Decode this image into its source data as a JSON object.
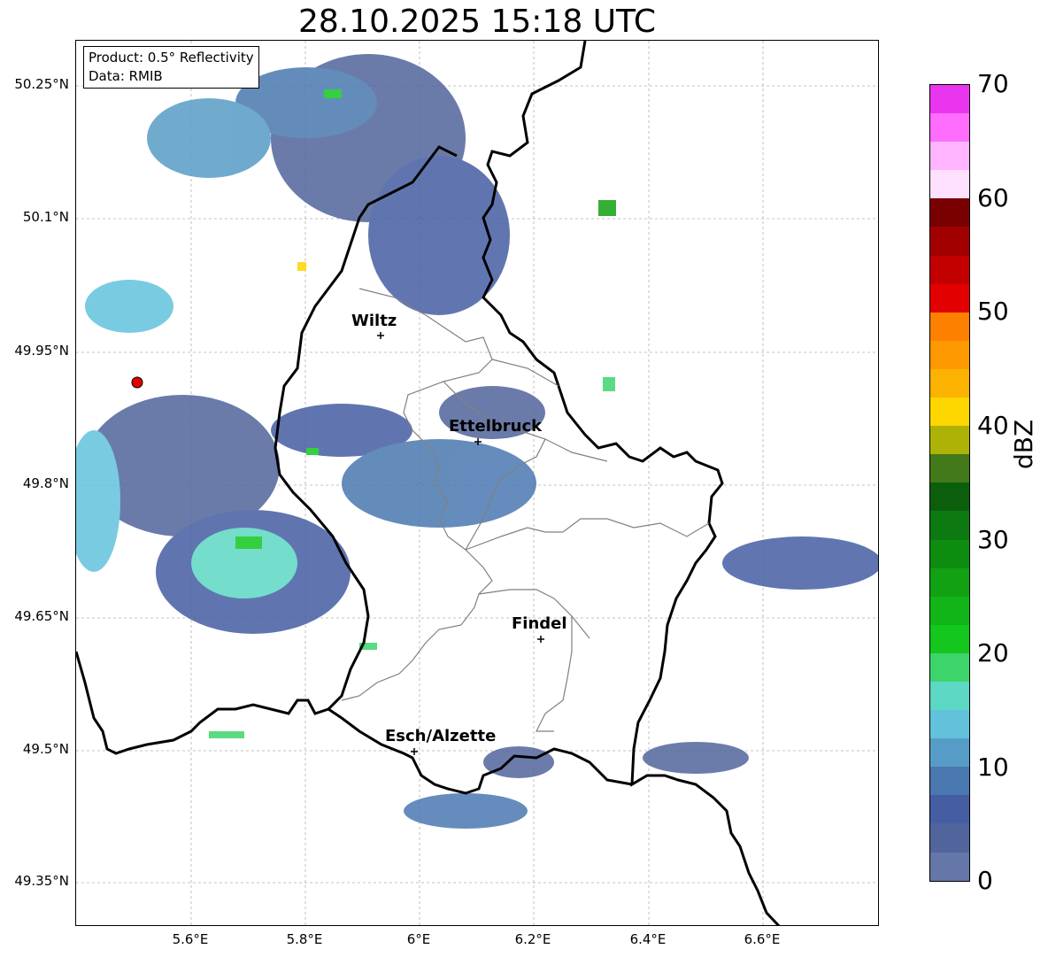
{
  "title": "28.10.2025 15:18 UTC",
  "info": {
    "product": "Product: 0.5° Reflectivity",
    "data": "Data: RMIB"
  },
  "lat_ticks": [
    "50.25°N",
    "50.1°N",
    "49.95°N",
    "49.8°N",
    "49.65°N",
    "49.5°N",
    "49.35°N"
  ],
  "lon_ticks": [
    "5.6°E",
    "5.8°E",
    "6°E",
    "6.2°E",
    "6.4°E",
    "6.6°E"
  ],
  "cities": {
    "wiltz": "Wiltz",
    "ettelbruck": "Ettelbruck",
    "findel": "Findel",
    "esch": "Esch/Alzette"
  },
  "colorbar": {
    "label": "dBZ",
    "ticks": [
      "70",
      "60",
      "50",
      "40",
      "30",
      "20",
      "10",
      "0"
    ],
    "colors": [
      "#6577a8",
      "#51659c",
      "#455ea3",
      "#4a78b0",
      "#579cc6",
      "#62c2dc",
      "#5cd8c4",
      "#3ed46c",
      "#13c71e",
      "#11b517",
      "#11a113",
      "#0e8c10",
      "#0c7a10",
      "#0b5f0c",
      "#43791a",
      "#aeb206",
      "#fed600",
      "#fcb200",
      "#fe9900",
      "#fe8000",
      "#e20000",
      "#c30000",
      "#a20000",
      "#780000",
      "#ffe0ff",
      "#ffb5ff",
      "#ff6dff",
      "#e936ee"
    ]
  },
  "radar_color": "#e00000"
}
